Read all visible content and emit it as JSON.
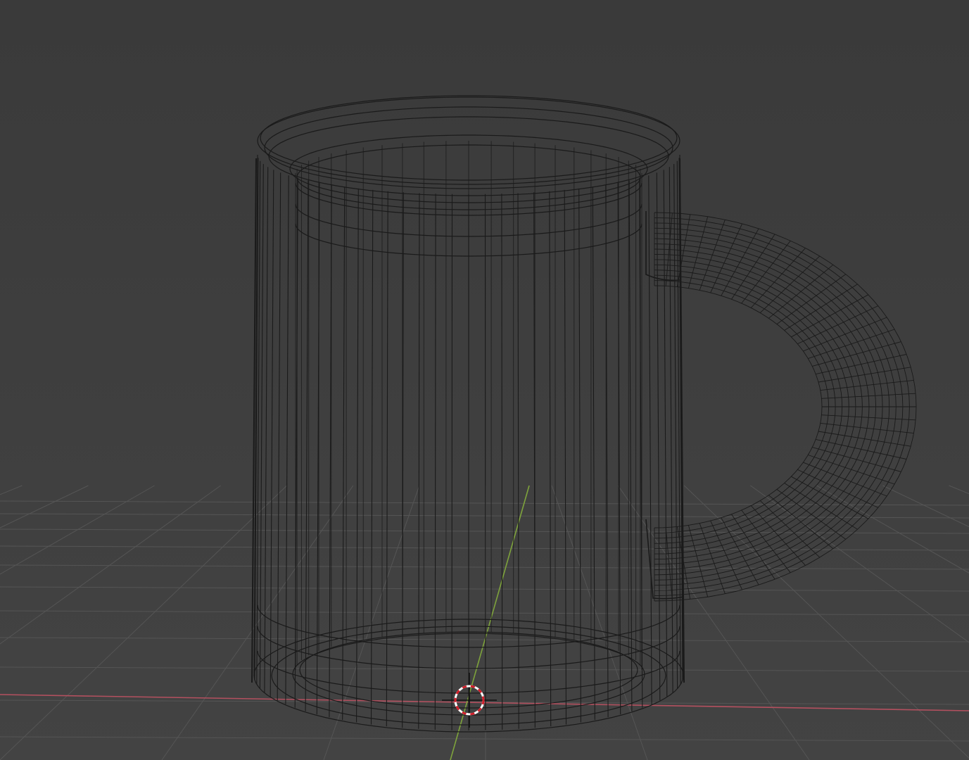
{
  "viewport": {
    "mode": "wireframe",
    "background_color": "#3d3d3d",
    "grid_color": "#555555",
    "x_axis_color": "#b4505f",
    "y_axis_color": "#7ea33c",
    "wire_color": "#1a1a1a"
  },
  "scene": {
    "object": "mug-mesh",
    "parts": [
      "mug-body",
      "mug-handle"
    ],
    "cursor": "3d-cursor-icon"
  }
}
